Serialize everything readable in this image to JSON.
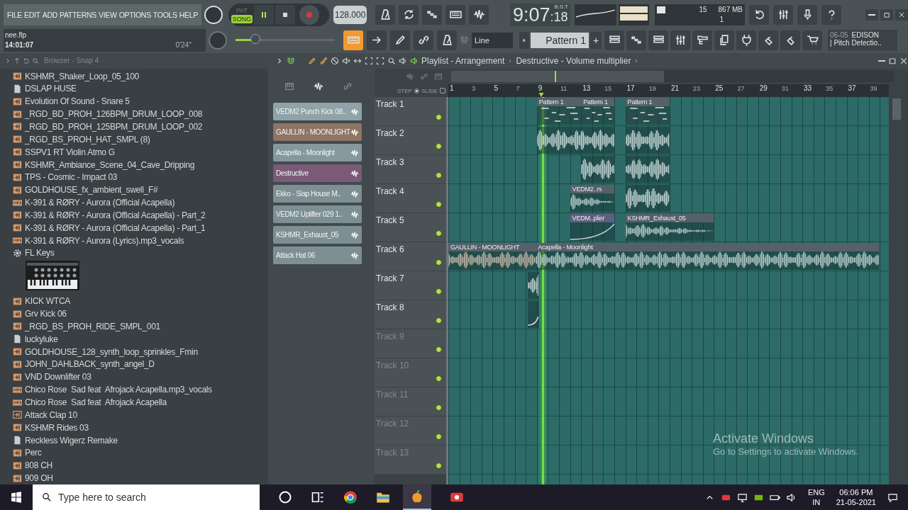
{
  "menu": [
    "FILE",
    "EDIT",
    "ADD",
    "PATTERNS",
    "VIEW",
    "OPTIONS",
    "TOOLS",
    "HELP"
  ],
  "project": {
    "file": "nee.flp",
    "time": "14:01:07",
    "duration": "0'24''"
  },
  "transport": {
    "modes": [
      {
        "label": "PAT",
        "selected": false
      },
      {
        "label": "SONG",
        "selected": true
      }
    ],
    "playing": true,
    "tempo": "128.000"
  },
  "main_pitch": {
    "level": 0.2
  },
  "clock": {
    "main": "9:07",
    "sub": ":18",
    "unit": "B:S:T"
  },
  "monitor": {
    "polyphony": "15",
    "memory": "867 MB",
    "cpu": "1"
  },
  "snap": {
    "value": "Line"
  },
  "pattern": {
    "name": "Pattern 1",
    "add": "+"
  },
  "hint": {
    "code": "06-05",
    "title": "EDISON",
    "text": "| Pitch Detectio.."
  },
  "browser": {
    "title": "Browser - Snap 4",
    "items": [
      {
        "label": "KSHMR_Shaker_Loop_05_100",
        "kind": "loop"
      },
      {
        "label": "DSLAP HUSE",
        "kind": "file"
      },
      {
        "label": "Evolution Of Sound - Snare 5",
        "kind": "loop"
      },
      {
        "label": "_RGD_BD_PROH_126BPM_DRUM_LOOP_008",
        "kind": "loop"
      },
      {
        "label": "_RGD_BD_PROH_125BPM_DRUM_LOOP_002",
        "kind": "loop"
      },
      {
        "label": "_RGD_BS_PROH_HAT_SMPL (8)",
        "kind": "loop"
      },
      {
        "label": "SSPV1 RT Violin Atmo G",
        "kind": "loop"
      },
      {
        "label": "KSHMR_Ambiance_Scene_04_Cave_Dripping",
        "kind": "loop"
      },
      {
        "label": "TPS - Cosmic - Impact 03",
        "kind": "loop"
      },
      {
        "label": "GOLDHOUSE_fx_ambient_swell_F#",
        "kind": "loop"
      },
      {
        "label": "K-391 & RØRY - Aurora (Official Acapella)",
        "kind": "mp3"
      },
      {
        "label": "K-391 & RØRY - Aurora (Official Acapella) - Part_2",
        "kind": "loop"
      },
      {
        "label": "K-391 & RØRY - Aurora (Official Acapella) - Part_1",
        "kind": "loop"
      },
      {
        "label": "K-391 & RØRY - Aurora (Lyrics).mp3_vocals",
        "kind": "mp3"
      },
      {
        "label": "FL Keys",
        "kind": "plugin"
      },
      {
        "label": "KICK WTCA",
        "kind": "loop"
      },
      {
        "label": "Grv Kick 06",
        "kind": "loop"
      },
      {
        "label": "_RGD_BS_PROH_RIDE_SMPL_001",
        "kind": "loop"
      },
      {
        "label": "luckyluke",
        "kind": "file"
      },
      {
        "label": "GOLDHOUSE_128_synth_loop_sprinkles_Fmin",
        "kind": "loop"
      },
      {
        "label": "JOHN_DAHLBACK_synth_angel_D",
        "kind": "loop"
      },
      {
        "label": "VND Downlifter 03",
        "kind": "loop"
      },
      {
        "label": "Chico Rose  Sad feat  Afrojack Acapella.mp3_vocals",
        "kind": "mp3"
      },
      {
        "label": "Chico Rose  Sad feat  Afrojack Acapella",
        "kind": "mp3"
      },
      {
        "label": "Attack Clap 10",
        "kind": "clap"
      },
      {
        "label": "KSHMR Rides 03",
        "kind": "loop"
      },
      {
        "label": "Reckless Wigerz Remake",
        "kind": "file"
      },
      {
        "label": "Perc",
        "kind": "loop"
      },
      {
        "label": "808 CH",
        "kind": "loop"
      },
      {
        "label": "909 OH",
        "kind": "loop"
      }
    ]
  },
  "channel_rack": {
    "channels": [
      {
        "name": "VEDM2 Punch Kick 08..",
        "color": "#8fa3a8"
      },
      {
        "name": "GAULLIN - MOONLIGHT",
        "color": "#8e7564"
      },
      {
        "name": "Acapella - Moonlight",
        "color": "#86989e"
      },
      {
        "name": "Destructive",
        "color": "#7b5a78"
      },
      {
        "name": "Ekko - Slap House M..",
        "color": "#7e8f94"
      },
      {
        "name": "VEDM2 Uplifter 029 1..",
        "color": "#7e8f94"
      },
      {
        "name": "KSHMR_Exhaust_05",
        "color": "#7e8f94"
      },
      {
        "name": "Attack Hat 06",
        "color": "#7e8f94"
      }
    ]
  },
  "playlist": {
    "title": "Playlist - Arrangement",
    "context": "Destructive - Volume multiplier",
    "step": {
      "label": "STEP",
      "selected": true
    },
    "slide": {
      "label": "SLIDE",
      "checked": false
    },
    "ruler": [
      "1",
      "3",
      "5",
      "7",
      "9",
      "11",
      "13",
      "15",
      "17",
      "19",
      "21",
      "23",
      "25",
      "27",
      "29",
      "31",
      "33",
      "35",
      "37",
      "39"
    ],
    "playhead": {
      "level": 0.213
    },
    "tracks": [
      {
        "name": "Track 1",
        "empty": false,
        "clips": [
          {
            "label": "Pattern 1",
            "kind": "pattern"
          },
          {
            "label": "Pattern 1",
            "kind": "pattern"
          },
          {
            "label": "Pattern 1",
            "kind": "pattern"
          }
        ]
      },
      {
        "name": "Track 2",
        "empty": false
      },
      {
        "name": "Track 3",
        "empty": false
      },
      {
        "name": "Track 4",
        "empty": false,
        "clips": [
          {
            "label": "VEDM2..rs",
            "kind": "audio"
          }
        ]
      },
      {
        "name": "Track 5",
        "empty": false,
        "clips": [
          {
            "label": "VEDM..plier",
            "kind": "automation"
          },
          {
            "label": "KSHMR_Exhaust_05",
            "kind": "audio"
          }
        ]
      },
      {
        "name": "Track 6",
        "empty": false,
        "clips": [
          {
            "label": "GAULLIN - MOONLIGHT",
            "kind": "audio"
          },
          {
            "label": "Acapella - Moonlight",
            "kind": "audio"
          }
        ]
      },
      {
        "name": "Track 7",
        "empty": false
      },
      {
        "name": "Track 8",
        "empty": false
      },
      {
        "name": "Track 9",
        "empty": true
      },
      {
        "name": "Track 10",
        "empty": true
      },
      {
        "name": "Track 11",
        "empty": true
      },
      {
        "name": "Track 12",
        "empty": true
      },
      {
        "name": "Track 13",
        "empty": true
      }
    ]
  },
  "activation": {
    "title": "Activate Windows",
    "text": "Go to Settings to activate Windows."
  },
  "taskbar": {
    "search": {
      "placeholder": "Type here to search"
    },
    "language": "ENG",
    "region": "IN",
    "time": "06:06 PM",
    "date": "21-05-2021"
  }
}
